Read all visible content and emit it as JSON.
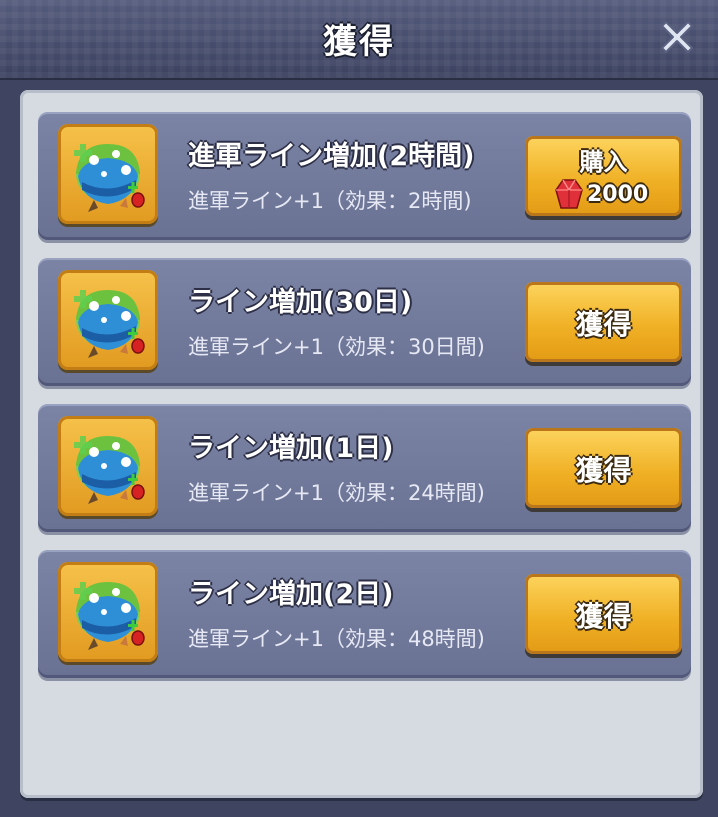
{
  "header": {
    "title": "獲得",
    "close_icon": "close-icon"
  },
  "items": [
    {
      "title": "進軍ライン増加(2時間)",
      "description": "進軍ライン+1（効果：2時間)",
      "button_label": "購入",
      "price": "2000",
      "price_icon": "gem-icon",
      "icon": "helmet-icon"
    },
    {
      "title": "ライン増加(30日)",
      "description": "進軍ライン+1（効果：30日間)",
      "button_label": "獲得",
      "icon": "helmet-icon"
    },
    {
      "title": "ライン増加(1日)",
      "description": "進軍ライン+1（効果：24時間)",
      "button_label": "獲得",
      "icon": "helmet-icon"
    },
    {
      "title": "ライン増加(2日)",
      "description": "進軍ライン+1（効果：48時間)",
      "button_label": "獲得",
      "icon": "helmet-icon"
    }
  ],
  "colors": {
    "button": "#f0b126",
    "row": "#7078a0",
    "panel": "#d6dbe2"
  }
}
